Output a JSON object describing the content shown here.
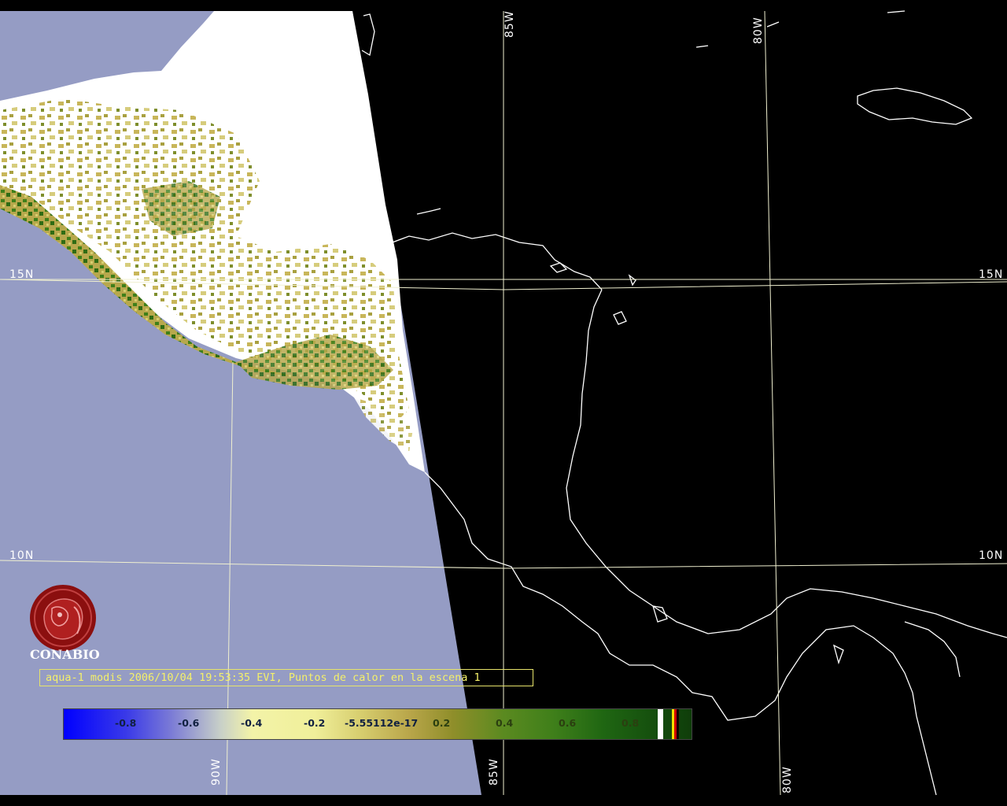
{
  "caption": "aqua-1 modis 2006/10/04 19:53:35 EVI, Puntos de calor en la escena 1",
  "logo_text": "CONABIO",
  "grid_labels": {
    "lat_15": "15N",
    "lat_10": "10N",
    "lon_90": "90W",
    "lon_85": "85W",
    "lon_80": "80W"
  },
  "legend": {
    "ticks": [
      "-0.8",
      "-0.6",
      "-0.4",
      "-0.2",
      "-5.55112e-17",
      "0.2",
      "0.4",
      "0.6",
      "0.8"
    ],
    "colors": {
      "low": "#0000ff",
      "mid": "#f3f3a8",
      "high": "#0f3d0a",
      "cloud": "#ffffff",
      "hotspot": "#d00000"
    }
  },
  "colors": {
    "no_data": "#959cc4",
    "ocean_night": "#000000",
    "coastline": "#ffffff",
    "graticule": "#f0f0d0",
    "caption_text": "#f4f06a",
    "logo": "#8b0f0f"
  }
}
